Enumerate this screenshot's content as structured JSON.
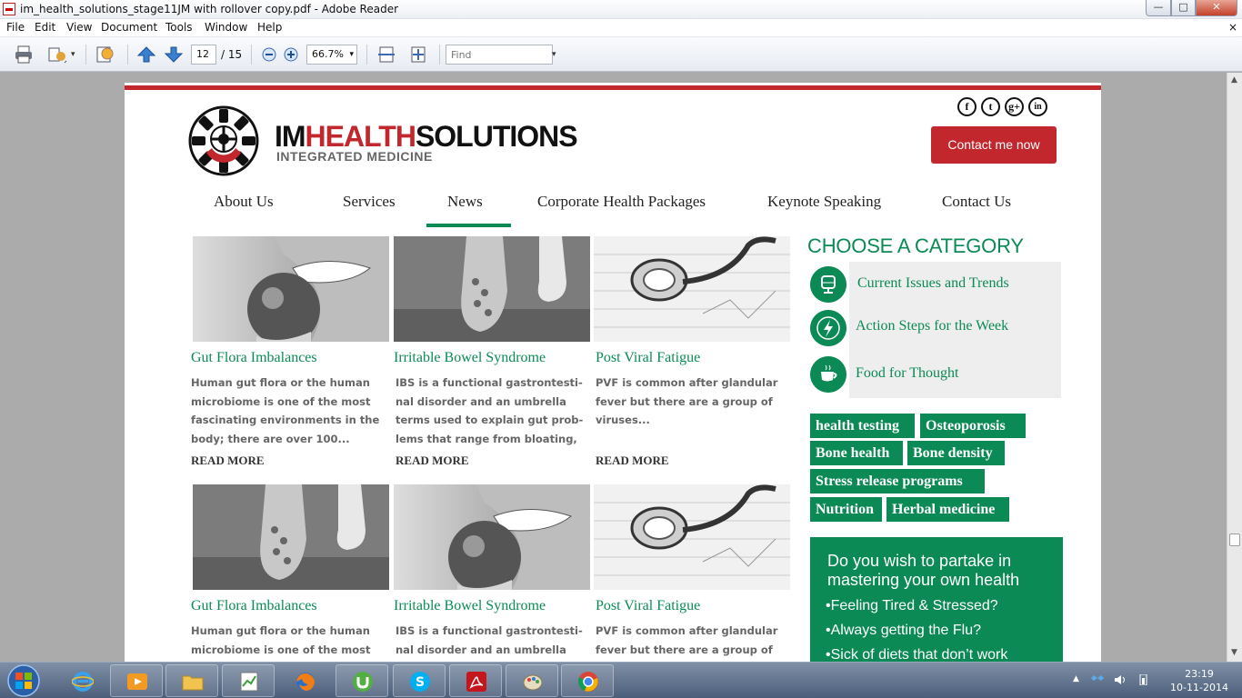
{
  "window": {
    "title": "im_health_solutions_stage11JM with rollover copy.pdf - Adobe Reader",
    "minimize_glyph": "—",
    "maximize_glyph": "□",
    "close_glyph": "✕"
  },
  "menu": {
    "items": [
      "File",
      "Edit",
      "View",
      "Document",
      "Tools",
      "Window",
      "Help"
    ],
    "close_glyph": "×"
  },
  "toolbar": {
    "current_page": "12",
    "page_total_label": "/ 15",
    "zoom": "66.7%",
    "find_placeholder": "Find",
    "dropdown_glyph": "▾"
  },
  "site": {
    "logo": {
      "part1": "IM",
      "part2": "HEALTH",
      "part3": "SOLUTIONS",
      "subtitle": "INTEGRATED MEDICINE"
    },
    "social": [
      "f",
      "t",
      "g+",
      "in"
    ],
    "contact_button": "Contact me now",
    "nav": [
      "About Us",
      "Services",
      "News",
      "Corporate Health Packages",
      "Keynote Speaking",
      "Contact Us"
    ],
    "active_nav": "News",
    "accent_color": "#0b8a55",
    "brand_red": "#c1272d",
    "cards": [
      {
        "title": "Gut Flora Imbalances",
        "body": "Human gut flora or the human microbiome is one of the most fascinating environments in the body; there are over 100...",
        "more": "READ MORE",
        "image": "apple-bite-photo"
      },
      {
        "title": "Irritable Bowel Syndrome",
        "body": "IBS is a functional gastrontesti-nal disorder and an umbrella terms used to explain gut prob-lems that range from bloating,",
        "more": "READ MORE",
        "image": "running-shoes-photo"
      },
      {
        "title": "Post Viral Fatigue",
        "body": "PVF is common after glandular fever but there are a group of viruses...",
        "more": "READ MORE",
        "image": "stethoscope-photo"
      },
      {
        "title": "Gut Flora Imbalances",
        "body": "Human gut flora or the human microbiome is one of the most",
        "image": "running-shoes-photo"
      },
      {
        "title": "Irritable Bowel Syndrome",
        "body": "IBS is a functional gastrontesti-nal disorder and an umbrella",
        "image": "apple-bite-photo"
      },
      {
        "title": "Post Viral Fatigue",
        "body": "PVF is common after glandular fever but there are a group of",
        "image": "stethoscope-photo"
      }
    ],
    "categories": {
      "heading": "CHOOSE A CATEGORY",
      "items": [
        {
          "label": "Current Issues and Trends",
          "icon": "microphone-icon"
        },
        {
          "label": "Action Steps for the Week",
          "icon": "lightning-icon"
        },
        {
          "label": "Food for Thought",
          "icon": "coffee-cup-icon"
        }
      ]
    },
    "tags": [
      "health testing",
      "Osteoporosis",
      "Bone health",
      "Bone density",
      "Stress release programs",
      "Nutrition",
      "Herbal medicine"
    ],
    "promo": {
      "title": "Do you wish to partake in mastering your own health",
      "items": [
        "•Feeling Tired & Stressed?",
        "•Always getting the Flu?",
        "•Sick of diets that don’t work"
      ]
    }
  },
  "taskbar": {
    "time": "23:19",
    "date": "10-11-2014",
    "apps": [
      "internet-explorer",
      "media-player",
      "file-explorer",
      "notepad-chart",
      "firefox",
      "utorrent",
      "skype",
      "adobe-reader",
      "paint",
      "chrome"
    ]
  }
}
